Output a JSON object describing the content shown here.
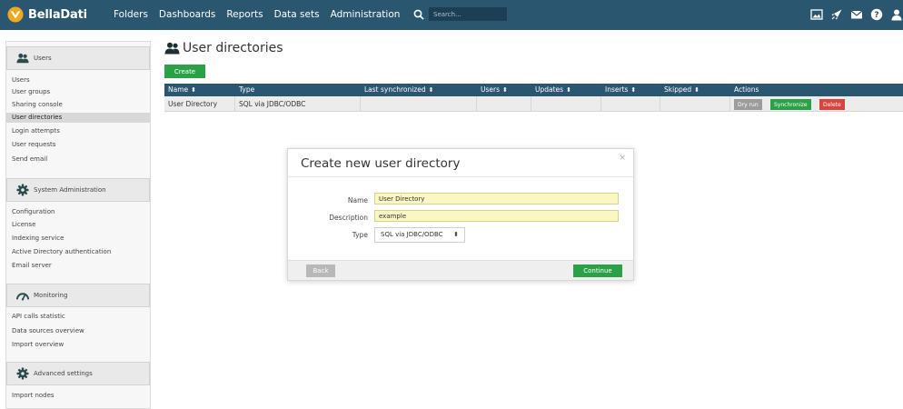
{
  "app": {
    "brand": "BellaDati",
    "nav": [
      "Folders",
      "Dashboards",
      "Reports",
      "Data sets",
      "Administration"
    ],
    "search_placeholder": "Search...",
    "top_icons": [
      "image-icon",
      "rocket-icon",
      "mail-icon",
      "help-icon",
      "user-icon"
    ]
  },
  "sidebar": {
    "sections": [
      {
        "title": "Users",
        "icon": "users-icon",
        "items": [
          "Users",
          "User groups",
          "Sharing console",
          "User directories",
          "Login attempts",
          "User requests",
          "Send email"
        ]
      },
      {
        "title": "System Administration",
        "icon": "gear-icon",
        "items": [
          "Configuration",
          "License",
          "Indexing service",
          "Active Directory authentication",
          "Email server"
        ]
      },
      {
        "title": "Monitoring",
        "icon": "gauge-icon",
        "items": [
          "API calls statistic",
          "Data sources overview",
          "Import overview"
        ]
      },
      {
        "title": "Advanced settings",
        "icon": "gear-icon",
        "items": [
          "Import nodes"
        ]
      }
    ],
    "active_item": "User directories"
  },
  "main": {
    "title": "User directories",
    "create_label": "Create",
    "table": {
      "columns": [
        "Name",
        "Type",
        "Last synchronized",
        "Users",
        "Updates",
        "Inserts",
        "Skipped",
        "Actions"
      ],
      "sortable": [
        true,
        false,
        true,
        true,
        true,
        true,
        true,
        false
      ],
      "rows": [
        {
          "name": "User Directory",
          "type": "SQL via JDBC/ODBC",
          "last_synchronized": "",
          "users": "",
          "updates": "",
          "inserts": "",
          "skipped": "",
          "actions": [
            "Dry run",
            "Synchronize",
            "Delete"
          ]
        }
      ]
    }
  },
  "modal": {
    "title": "Create new user directory",
    "close": "×",
    "fields": {
      "name_label": "Name",
      "name_value": "User Directory",
      "description_label": "Description",
      "description_value": "example",
      "type_label": "Type",
      "type_value": "SQL via JDBC/ODBC"
    },
    "back_label": "Back",
    "continue_label": "Continue"
  },
  "colors": {
    "header": "#2b5670",
    "primary_green": "#2aa147",
    "danger_red": "#d9443c",
    "input_highlight": "#fbf7c3"
  }
}
